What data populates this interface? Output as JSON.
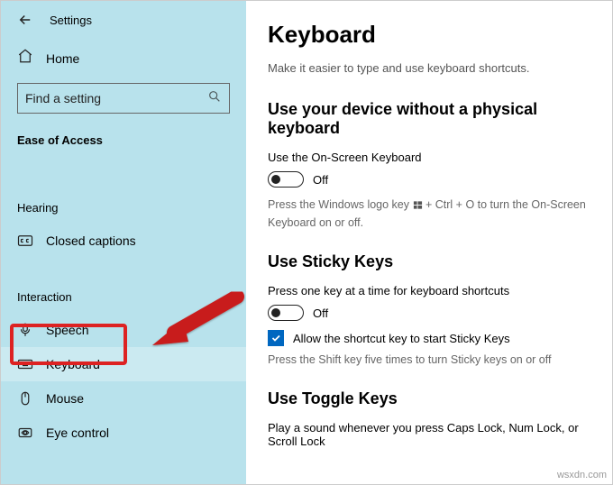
{
  "header": {
    "title": "Settings"
  },
  "home_label": "Home",
  "search": {
    "placeholder": "Find a setting"
  },
  "sidebar": {
    "group_ease": "Ease of Access",
    "group_hearing": "Hearing",
    "group_interaction": "Interaction",
    "items": {
      "closed_captions": "Closed captions",
      "speech": "Speech",
      "keyboard": "Keyboard",
      "mouse": "Mouse",
      "eye_control": "Eye control"
    }
  },
  "page": {
    "title": "Keyboard",
    "subtitle": "Make it easier to type and use keyboard shortcuts."
  },
  "section_osk": {
    "title": "Use your device without a physical keyboard",
    "field": "Use the On-Screen Keyboard",
    "state": "Off",
    "hint_prefix": "Press the Windows logo key ",
    "hint_suffix": " + Ctrl + O to turn the On-Screen Keyboard on or off."
  },
  "section_sticky": {
    "title": "Use Sticky Keys",
    "field": "Press one key at a time for keyboard shortcuts",
    "state": "Off",
    "cb_label": "Allow the shortcut key to start Sticky Keys",
    "hint": "Press the Shift key five times to turn Sticky keys on or off"
  },
  "section_toggle": {
    "title": "Use Toggle Keys",
    "field": "Play a sound whenever you press Caps Lock, Num Lock, or Scroll Lock"
  },
  "watermark": "wsxdn.com"
}
